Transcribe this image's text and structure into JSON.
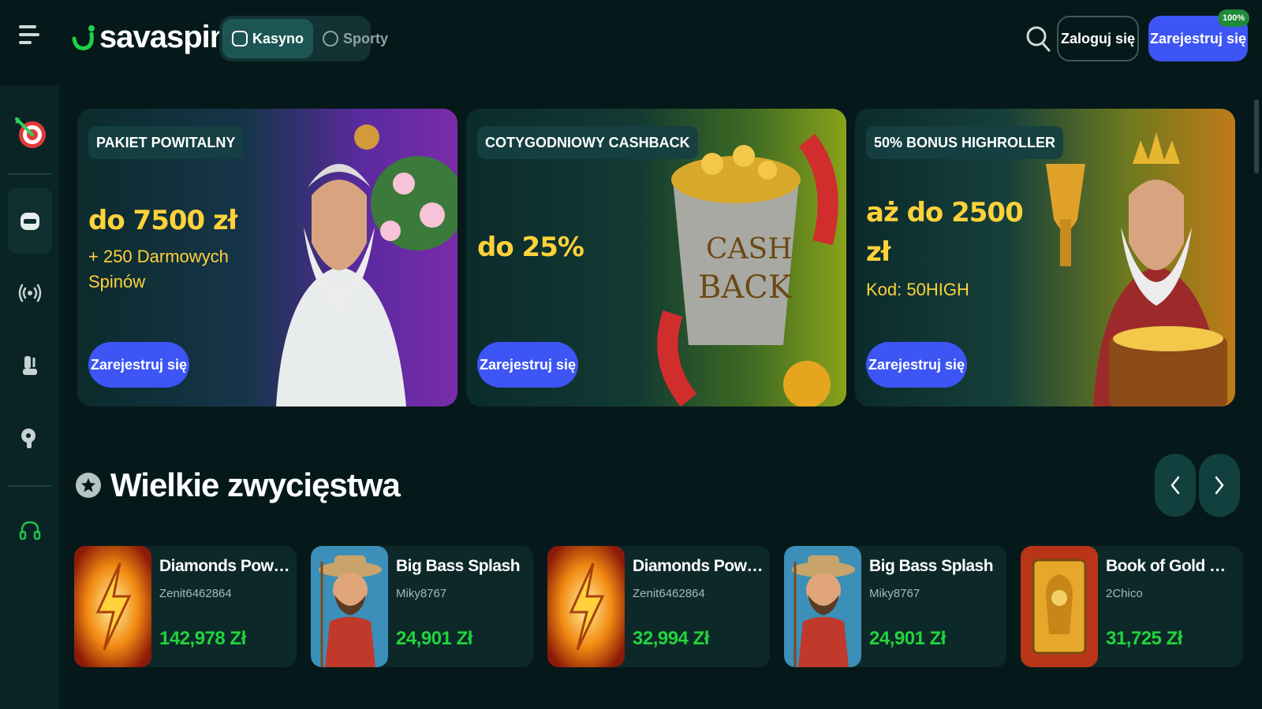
{
  "header": {
    "brand": "savaspin",
    "switch": [
      {
        "label": "Kasyno",
        "active": true
      },
      {
        "label": "Sporty",
        "active": false
      }
    ],
    "login_label": "Zaloguj się",
    "register_label": "Zarejestruj się",
    "register_badge": "100%"
  },
  "colors": {
    "background": "#06191a",
    "sidebar": "#0a2425",
    "accent_blue": "#3d55f5",
    "promo_yellow": "#ffd23a",
    "win_green": "#22d33c"
  },
  "sidebar": {
    "items": [
      {
        "icon": "target-icon"
      },
      {
        "icon": "slot-machine-icon",
        "active": true
      },
      {
        "icon": "live-broadcast-icon"
      },
      {
        "icon": "joystick-icon"
      },
      {
        "icon": "roulette-icon"
      },
      {
        "icon": "headset-icon"
      }
    ]
  },
  "banners": [
    {
      "tag": "PAKIET POWITALNY",
      "amount": "do 7500 zł",
      "sub_line1": "+ 250 Darmowych",
      "sub_line2": "Spinów",
      "button": "Zarejestruj się"
    },
    {
      "tag": "COTYGODNIOWY CASHBACK",
      "amount": "do 25%",
      "art_text_1": "CASH",
      "art_text_2": "BACK",
      "button": "Zarejestruj się"
    },
    {
      "tag": "50% BONUS HIGHROLLER",
      "amount_line1": "aż do 2500",
      "amount_line2": "zł",
      "sub_line1": "Kod: 50HIGH",
      "button": "Zarejestruj się"
    }
  ],
  "big_wins": {
    "title": "Wielkie zwycięstwa",
    "items": [
      {
        "game": "Diamonds Power: ...",
        "user": "Zenit6462864",
        "amount": "142,978 Zł",
        "thumb": "lightning"
      },
      {
        "game": "Big Bass Splash",
        "user": "Miky8767",
        "amount": "24,901 Zł",
        "thumb": "fisherman"
      },
      {
        "game": "Diamonds Power: ...",
        "user": "Zenit6462864",
        "amount": "32,994 Zł",
        "thumb": "lightning"
      },
      {
        "game": "Big Bass Splash",
        "user": "Miky8767",
        "amount": "24,901 Zł",
        "thumb": "fisherman"
      },
      {
        "game": "Book of Gold Mult...",
        "user": "2Chico",
        "amount": "31,725 Zł",
        "thumb": "book"
      }
    ]
  }
}
